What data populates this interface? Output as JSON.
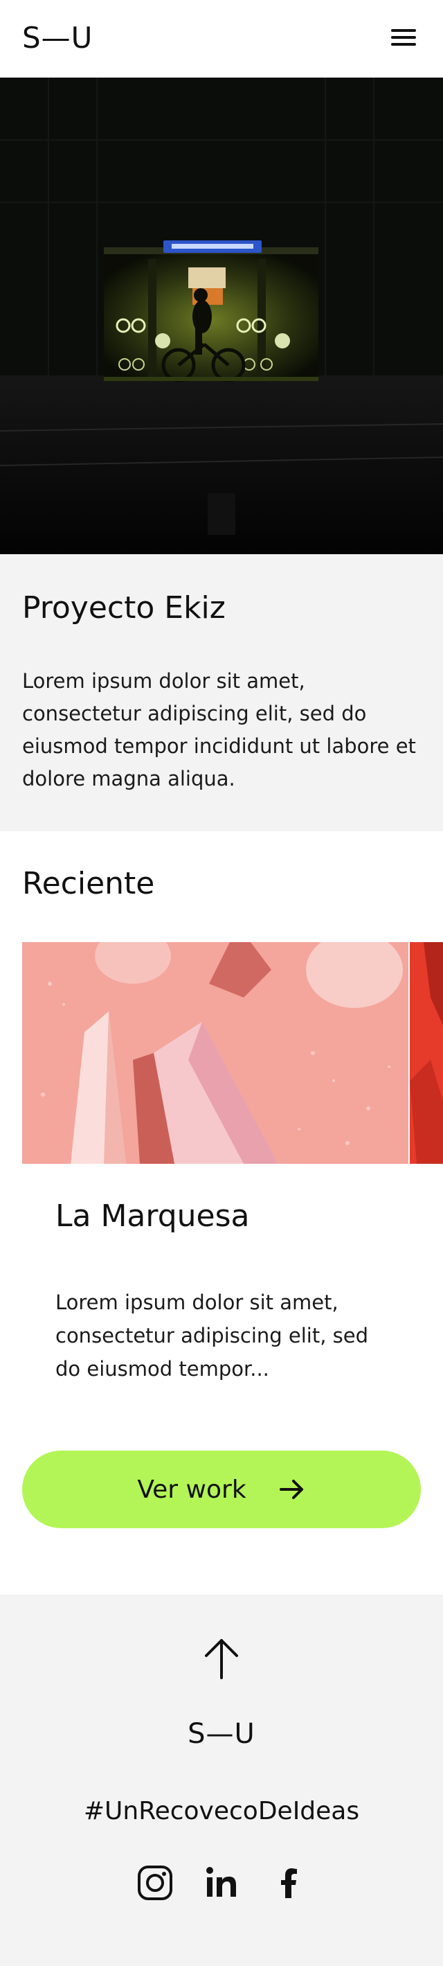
{
  "header": {
    "logo": "S—U",
    "menu_icon": "hamburger-menu-icon"
  },
  "hero": {
    "image": "night-bicycle-parking-photo"
  },
  "project": {
    "title": "Proyecto Ekiz",
    "description": "Lorem ipsum dolor sit amet, consectetur adipiscing elit, sed do eiusmod tempor incididunt ut labore et dolore magna aliqua."
  },
  "recent": {
    "heading": "Reciente",
    "card": {
      "image": "pink-crystals-photo",
      "title": "La Marquesa",
      "excerpt": "Lorem ipsum dolor sit amet, consectetur adipiscing elit, sed do eiusmod tempor...",
      "button_label": "Ver work",
      "button_icon": "arrow-right-icon"
    }
  },
  "footer": {
    "up_icon": "arrow-up-icon",
    "logo": "S—U",
    "hashtag": "#UnRecovecoDeIdeas",
    "social": [
      "instagram-icon",
      "linkedin-icon",
      "facebook-icon"
    ]
  },
  "colors": {
    "accent": "#b3f556",
    "text": "#111111",
    "section_bg": "#f3f3f3",
    "card_pink": "#f4a59c"
  }
}
